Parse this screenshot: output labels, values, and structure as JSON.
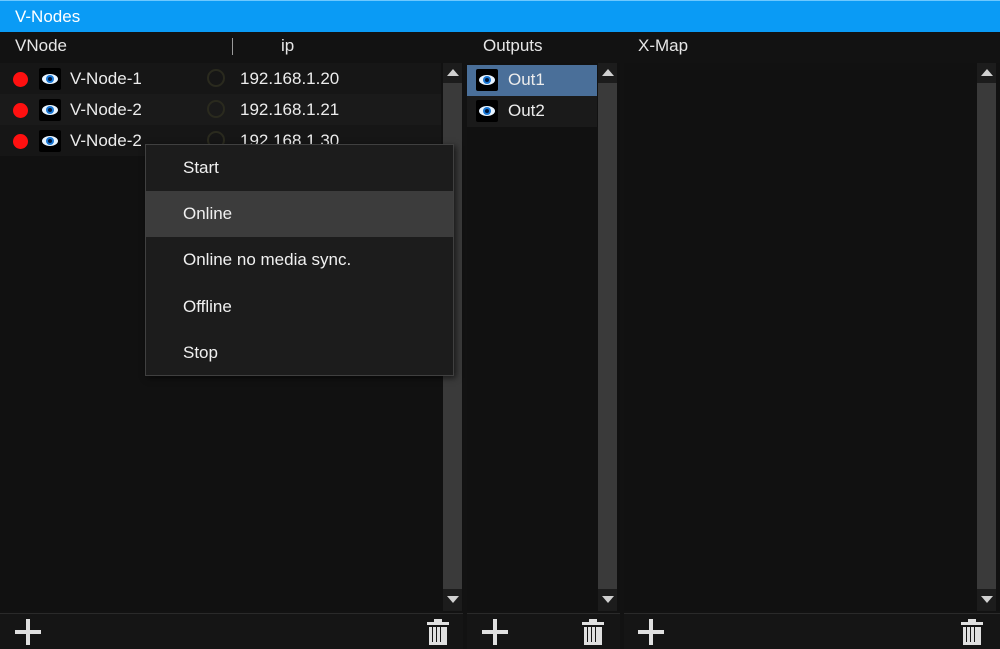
{
  "window": {
    "title": "V-Nodes"
  },
  "columns": {
    "vnode": "VNode",
    "ip": "ip",
    "outputs": "Outputs",
    "xmap": "X-Map"
  },
  "vnodes": [
    {
      "name": "V-Node-1",
      "ip": "192.168.1.20",
      "status_color": "#ff1010",
      "icon": "eye-icon"
    },
    {
      "name": "V-Node-2",
      "ip": "192.168.1.21",
      "status_color": "#ff1010",
      "icon": "eye-icon"
    },
    {
      "name": "V-Node-2",
      "ip": "192.168.1.30",
      "status_color": "#ff1010",
      "icon": "eye-icon"
    }
  ],
  "outputs": [
    {
      "name": "Out1",
      "selected": true,
      "icon": "eye-icon"
    },
    {
      "name": "Out2",
      "selected": false,
      "icon": "eye-icon"
    }
  ],
  "context_menu": {
    "items": [
      {
        "label": "Start"
      },
      {
        "label": "Online",
        "highlighted": true
      },
      {
        "label": "Online no media sync."
      },
      {
        "label": "Offline"
      },
      {
        "label": "Stop"
      }
    ]
  },
  "footer": {
    "add_icon": "plus-icon",
    "delete_icon": "trash-icon"
  },
  "colors": {
    "accent": "#0a9bf5",
    "selection": "#4a6f99",
    "status_offline": "#ff1010"
  }
}
